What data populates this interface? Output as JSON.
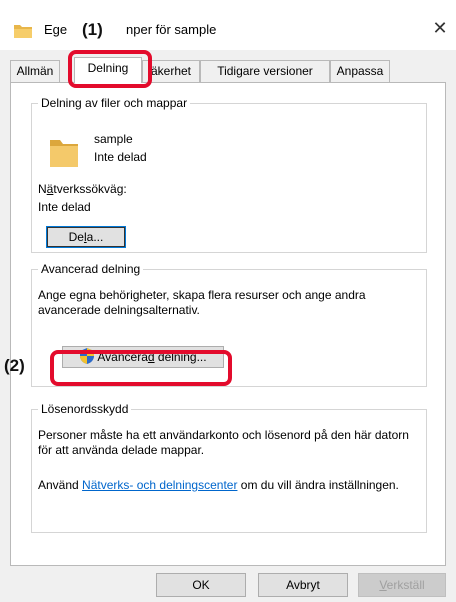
{
  "window": {
    "title_left": "Ege",
    "title_right": "nper för sample",
    "close_glyph": "✕"
  },
  "tabs": [
    {
      "label": "Allmän"
    },
    {
      "label": "Delning"
    },
    {
      "label": "äkerhet"
    },
    {
      "label": "Tidigare versioner"
    },
    {
      "label": "Anpassa"
    }
  ],
  "sharing": {
    "legend": "Delning av filer och mappar",
    "folder_name": "sample",
    "folder_status": "Inte delad",
    "path_label_pre": "N",
    "path_label_accel": "ä",
    "path_label_post": "tverkssökväg:",
    "path_value": "Inte delad",
    "share_button_pre": "De",
    "share_button_accel": "l",
    "share_button_post": "a..."
  },
  "advanced": {
    "legend": "Avancerad delning",
    "description": "Ange egna behörigheter, skapa flera resurser och ange andra avancerade delningsalternativ.",
    "button_pre": "Avancera",
    "button_accel": "d",
    "button_post": " delning..."
  },
  "password": {
    "legend": "Lösenordsskydd",
    "description": "Personer måste ha ett användarkonto och lösenord på den här datorn för att använda delade mappar.",
    "link_prefix": "Använd ",
    "link_text": "Nätverks- och delningscenter",
    "link_suffix": " om du vill ändra inställningen."
  },
  "footer": {
    "ok": "OK",
    "cancel": "Avbryt",
    "apply_pre": "",
    "apply_accel": "V",
    "apply_post": "erkställ"
  },
  "callouts": {
    "one": "(1)",
    "two": "(2)",
    "color": "#e30b2c"
  },
  "icons": {
    "folder": "folder-icon",
    "shield": "uac-shield-icon"
  }
}
